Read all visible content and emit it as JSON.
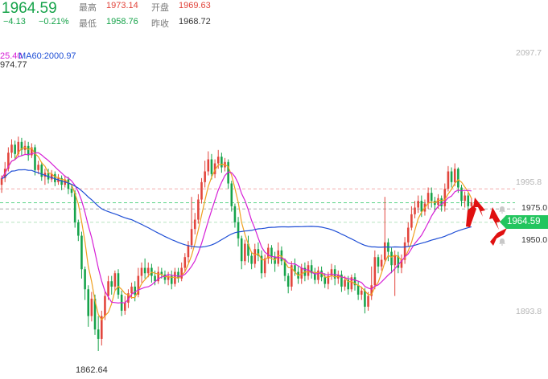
{
  "quote": {
    "price": "1964.59",
    "change": "−4.13",
    "change_pct": "−0.21%",
    "high_label": "最高",
    "high": "1973.14",
    "open_label": "开盘",
    "open": "1969.63",
    "low_label": "最低",
    "low": "1958.76",
    "prev_close_label": "昨收",
    "prev_close": "1968.72"
  },
  "indicators": {
    "ma_fast": "25.40",
    "ma60": "MA60:2000.97"
  },
  "annotations": {
    "high_value": "974.77",
    "low_value": "1862.64",
    "current_tag": "1964.59",
    "level_upper": "1975.0",
    "level_lower": "1950.0"
  },
  "axis": {
    "y_ticks": [
      "2097.7",
      "1995.8",
      "1893.8"
    ]
  },
  "colors": {
    "up": "#e2453c",
    "down": "#16a34a",
    "ma_fast": "#f0a020",
    "ma_mid": "#d61fd6",
    "ma60": "#1f4fd6",
    "alert": "#e01010"
  },
  "chart_data": {
    "type": "candlestick",
    "ylim": [
      1845,
      2110
    ],
    "y_ticks": [
      2097.7,
      1995.8,
      1893.8
    ],
    "reference_lines": [
      1975.0,
      1964.59,
      1960.0,
      1950.0
    ],
    "candles": [
      [
        1978,
        1983,
        1972,
        1985
      ],
      [
        1983,
        1990,
        1980,
        1995
      ],
      [
        1990,
        2002,
        1988,
        2006
      ],
      [
        2002,
        2008,
        1998,
        2012
      ],
      [
        2008,
        2001,
        1997,
        2011
      ],
      [
        2001,
        2010,
        1999,
        2014
      ],
      [
        2010,
        2004,
        2000,
        2013
      ],
      [
        2004,
        2007,
        2001,
        2011
      ],
      [
        2007,
        2000,
        1996,
        2010
      ],
      [
        2000,
        2006,
        1998,
        2009
      ],
      [
        2006,
        1989,
        1985,
        2008
      ],
      [
        1989,
        1993,
        1986,
        1996
      ],
      [
        1993,
        1984,
        1981,
        1995
      ],
      [
        1984,
        1987,
        1978,
        1990
      ],
      [
        1987,
        1982,
        1979,
        1990
      ],
      [
        1982,
        1986,
        1980,
        1989
      ],
      [
        1986,
        1980,
        1977,
        1988
      ],
      [
        1980,
        1983,
        1978,
        1986
      ],
      [
        1983,
        1978,
        1974,
        1985
      ],
      [
        1978,
        1982,
        1976,
        1985
      ],
      [
        1982,
        1975,
        1971,
        1984
      ],
      [
        1975,
        1972,
        1969,
        1978
      ],
      [
        1972,
        1950,
        1946,
        1974
      ],
      [
        1950,
        1940,
        1936,
        1952
      ],
      [
        1940,
        1915,
        1908,
        1943
      ],
      [
        1915,
        1900,
        1892,
        1917
      ],
      [
        1900,
        1880,
        1872,
        1903
      ],
      [
        1880,
        1893,
        1876,
        1898
      ],
      [
        1893,
        1870,
        1866,
        1896
      ],
      [
        1870,
        1863,
        1854,
        1880
      ],
      [
        1863,
        1880,
        1858,
        1884
      ],
      [
        1880,
        1895,
        1877,
        1899
      ],
      [
        1895,
        1906,
        1892,
        1910
      ],
      [
        1906,
        1902,
        1896,
        1910
      ],
      [
        1902,
        1912,
        1899,
        1914
      ],
      [
        1912,
        1896,
        1893,
        1915
      ],
      [
        1896,
        1884,
        1880,
        1899
      ],
      [
        1884,
        1890,
        1881,
        1895
      ],
      [
        1890,
        1897,
        1886,
        1900
      ],
      [
        1897,
        1902,
        1893,
        1905
      ],
      [
        1902,
        1896,
        1891,
        1906
      ],
      [
        1896,
        1910,
        1894,
        1916
      ],
      [
        1910,
        1916,
        1905,
        1920
      ],
      [
        1916,
        1912,
        1908,
        1923
      ],
      [
        1912,
        1916,
        1909,
        1920
      ],
      [
        1916,
        1910,
        1905,
        1919
      ],
      [
        1910,
        1906,
        1903,
        1914
      ],
      [
        1906,
        1913,
        1904,
        1917
      ],
      [
        1913,
        1911,
        1908,
        1916
      ],
      [
        1911,
        1907,
        1904,
        1914
      ],
      [
        1907,
        1910,
        1903,
        1913
      ],
      [
        1910,
        1904,
        1900,
        1914
      ],
      [
        1904,
        1913,
        1902,
        1916
      ],
      [
        1913,
        1908,
        1905,
        1916
      ],
      [
        1908,
        1916,
        1906,
        1920
      ],
      [
        1916,
        1924,
        1913,
        1927
      ],
      [
        1924,
        1933,
        1920,
        1936
      ],
      [
        1933,
        1945,
        1930,
        1969
      ],
      [
        1945,
        1952,
        1941,
        1957
      ],
      [
        1952,
        1967,
        1949,
        1971
      ],
      [
        1967,
        1980,
        1964,
        1983
      ],
      [
        1980,
        1988,
        1976,
        1996
      ],
      [
        1988,
        1997,
        1985,
        2003
      ],
      [
        1997,
        1986,
        1982,
        2001
      ],
      [
        1986,
        1994,
        1983,
        1997
      ],
      [
        1994,
        1999,
        1990,
        2004
      ],
      [
        1999,
        1991,
        1987,
        2002
      ],
      [
        1991,
        1995,
        1988,
        1998
      ],
      [
        1995,
        1979,
        1975,
        1997
      ],
      [
        1979,
        1962,
        1958,
        1981
      ],
      [
        1962,
        1950,
        1946,
        1964
      ],
      [
        1950,
        1938,
        1932,
        1954
      ],
      [
        1938,
        1921,
        1915,
        1940
      ],
      [
        1921,
        1934,
        1918,
        1937
      ],
      [
        1934,
        1925,
        1920,
        1940
      ],
      [
        1925,
        1919,
        1915,
        1928
      ],
      [
        1919,
        1930,
        1916,
        1934
      ],
      [
        1930,
        1925,
        1921,
        1935
      ],
      [
        1925,
        1912,
        1908,
        1929
      ],
      [
        1912,
        1923,
        1909,
        1926
      ],
      [
        1923,
        1931,
        1919,
        1934
      ],
      [
        1931,
        1924,
        1919,
        1933
      ],
      [
        1924,
        1919,
        1913,
        1928
      ],
      [
        1919,
        1929,
        1917,
        1935
      ],
      [
        1929,
        1921,
        1918,
        1932
      ],
      [
        1921,
        1910,
        1906,
        1923
      ],
      [
        1910,
        1902,
        1897,
        1912
      ],
      [
        1902,
        1918,
        1899,
        1921
      ],
      [
        1918,
        1913,
        1910,
        1923
      ],
      [
        1913,
        1908,
        1904,
        1917
      ],
      [
        1908,
        1916,
        1904,
        1919
      ],
      [
        1916,
        1910,
        1906,
        1920
      ],
      [
        1910,
        1918,
        1907,
        1921
      ],
      [
        1918,
        1912,
        1908,
        1922
      ],
      [
        1912,
        1907,
        1904,
        1916
      ],
      [
        1907,
        1914,
        1904,
        1917
      ],
      [
        1914,
        1909,
        1906,
        1917
      ],
      [
        1909,
        1904,
        1901,
        1912
      ],
      [
        1904,
        1910,
        1900,
        1913
      ],
      [
        1910,
        1915,
        1907,
        1919
      ],
      [
        1915,
        1908,
        1903,
        1918
      ],
      [
        1908,
        1911,
        1904,
        1914
      ],
      [
        1911,
        1902,
        1898,
        1914
      ],
      [
        1902,
        1907,
        1899,
        1910
      ],
      [
        1907,
        1900,
        1896,
        1910
      ],
      [
        1900,
        1909,
        1898,
        1911
      ],
      [
        1909,
        1903,
        1899,
        1912
      ],
      [
        1903,
        1896,
        1892,
        1906
      ],
      [
        1896,
        1899,
        1892,
        1902
      ],
      [
        1899,
        1887,
        1882,
        1901
      ],
      [
        1887,
        1895,
        1884,
        1898
      ],
      [
        1895,
        1903,
        1892,
        1917
      ],
      [
        1903,
        1924,
        1900,
        1929
      ],
      [
        1924,
        1917,
        1912,
        1926
      ],
      [
        1917,
        1922,
        1914,
        1926
      ],
      [
        1922,
        1935,
        1919,
        1969
      ],
      [
        1935,
        1928,
        1921,
        1938
      ],
      [
        1928,
        1918,
        1912,
        1931
      ],
      [
        1918,
        1925,
        1895,
        1929
      ],
      [
        1925,
        1916,
        1912,
        1928
      ],
      [
        1916,
        1922,
        1912,
        1926
      ],
      [
        1922,
        1935,
        1919,
        1939
      ],
      [
        1935,
        1946,
        1932,
        1950
      ],
      [
        1946,
        1956,
        1944,
        1962
      ],
      [
        1956,
        1961,
        1953,
        1966
      ],
      [
        1961,
        1966,
        1957,
        1970
      ],
      [
        1966,
        1958,
        1954,
        1970
      ],
      [
        1958,
        1964,
        1955,
        1967
      ],
      [
        1964,
        1972,
        1960,
        1976
      ],
      [
        1972,
        1966,
        1961,
        1976
      ],
      [
        1966,
        1963,
        1958,
        1969
      ],
      [
        1963,
        1968,
        1960,
        1971
      ],
      [
        1968,
        1962,
        1958,
        1970
      ],
      [
        1962,
        1975,
        1958,
        1979
      ],
      [
        1975,
        1988,
        1973,
        1992
      ],
      [
        1988,
        1980,
        1976,
        1991
      ],
      [
        1980,
        1990,
        1977,
        1994
      ],
      [
        1990,
        1976,
        1972,
        1991
      ],
      [
        1976,
        1966,
        1962,
        1978
      ],
      [
        1966,
        1970,
        1961,
        1973
      ],
      [
        1970,
        1962,
        1958,
        1972
      ],
      [
        1962,
        1965,
        1956,
        1968
      ]
    ],
    "series": [
      {
        "type": "line",
        "values": []
      },
      {
        "type": "line",
        "values": []
      },
      {
        "type": "line",
        "values": []
      }
    ]
  }
}
